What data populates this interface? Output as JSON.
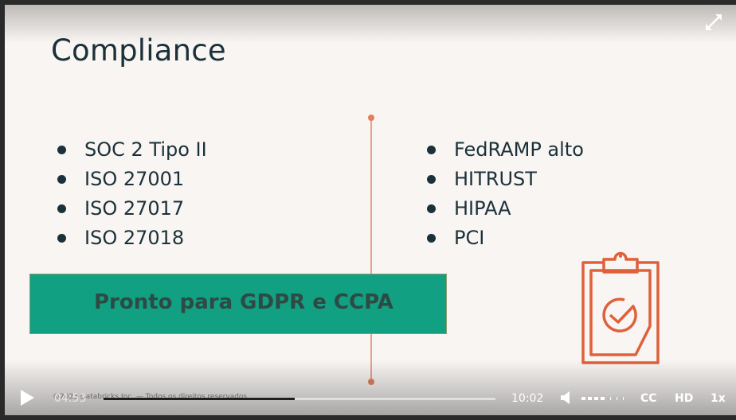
{
  "slide": {
    "title": "Compliance",
    "left_items": [
      "SOC 2 Tipo II",
      "ISO 27001",
      "ISO 27017",
      "ISO 27018"
    ],
    "right_items": [
      "FedRAMP alto",
      "HITRUST",
      "HIPAA",
      "PCI"
    ],
    "banner": "Pronto para GDPR e CCPA",
    "footer": "©2023 Databricks Inc. — Todos os direitos reservados"
  },
  "player": {
    "current_time": "04:53",
    "duration": "10:02",
    "progress_fraction": 0.487,
    "volume_fraction": 0.55,
    "cc_label": "CC",
    "hd_label": "HD",
    "speed_label": "1x"
  },
  "colors": {
    "slide_bg": "#f8f5f3",
    "text_dark": "#1b3139",
    "banner_bg": "#12a083",
    "accent": "#e0805e"
  }
}
